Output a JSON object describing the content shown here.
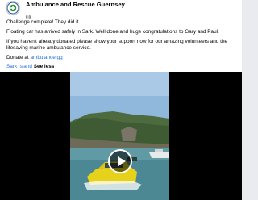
{
  "post": {
    "page_name": "Ambulance and Rescue Guernsey",
    "avatar_icon": "ambulance-rescue-logo",
    "audience_icon": "globe-icon",
    "lines": {
      "line1": "Challenge complete! They did it.",
      "line2": "Floating car has arrived safely in Sark. Well done and huge congratulations to Gary and Paul.",
      "line3": "If you haven't already donated please show your support now for our amazing volunteers and the",
      "line4": "lifesaving marine ambulance service.",
      "donate_prefix": "Donate at ",
      "donate_link": "ambulance.gg",
      "location_tag": "Sark Island",
      "see_less": "See less"
    },
    "video": {
      "play_icon": "play-icon",
      "colors": {
        "sky": "#8fb8dc",
        "hills": "#3e5b34",
        "sea": "#5f9aa5",
        "car": "#e6d21a"
      }
    }
  }
}
